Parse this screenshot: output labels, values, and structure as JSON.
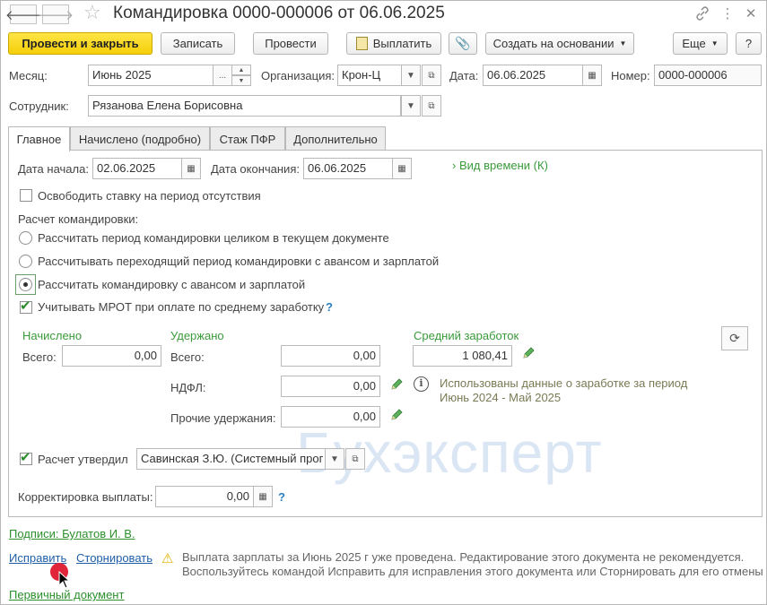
{
  "window": {
    "title": "Командировка 0000-000006 от 06.06.2025"
  },
  "toolbar": {
    "post_close": "Провести и закрыть",
    "save": "Записать",
    "post": "Провести",
    "pay": "Выплатить",
    "create_based": "Создать на основании",
    "more": "Еще",
    "help": "?"
  },
  "header": {
    "month_label": "Месяц:",
    "month_value": "Июнь 2025",
    "org_label": "Организация:",
    "org_value": "Крон-Ц",
    "date_label": "Дата:",
    "date_value": "06.06.2025",
    "number_label": "Номер:",
    "number_value": "0000-000006",
    "employee_label": "Сотрудник:",
    "employee_value": "Рязанова Елена Борисовна"
  },
  "tabs": [
    {
      "label": "Главное",
      "active": true
    },
    {
      "label": "Начислено (подробно)",
      "active": false
    },
    {
      "label": "Стаж ПФР",
      "active": false
    },
    {
      "label": "Дополнительно",
      "active": false
    }
  ],
  "main": {
    "start_label": "Дата начала:",
    "start_value": "02.06.2025",
    "end_label": "Дата окончания:",
    "end_value": "06.06.2025",
    "time_view": "Вид времени (К)",
    "free_rate": "Освободить ставку на период отсутствия",
    "calc_label": "Расчет командировки:",
    "options": [
      "Рассчитать период командировки целиком в текущем документе",
      "Рассчитывать переходящий период командировки с авансом и зарплатой",
      "Рассчитать командировку с авансом и зарплатой"
    ],
    "selected_option": 2,
    "mrot": "Учитывать МРОТ при оплате по среднему заработку",
    "mrot_checked": true,
    "help_mark": "?",
    "accrued_header": "Начислено",
    "withheld_header": "Удержано",
    "avg_header": "Средний заработок",
    "total_label": "Всего:",
    "accrued_total": "0,00",
    "withheld_total": "0,00",
    "ndfl_label": "НДФЛ:",
    "ndfl_value": "0,00",
    "other_label": "Прочие удержания:",
    "other_value": "0,00",
    "avg_value": "1 080,41",
    "info_text_1": "Использованы данные о заработке за период",
    "info_text_2": "Июнь 2024 - Май 2025",
    "approved_label": "Расчет утвердил",
    "approved_checked": true,
    "approved_value": "Савинская З.Ю. (Системный прог",
    "correction_label": "Корректировка выплаты:",
    "correction_value": "0,00"
  },
  "watermark": "Бухэксперт",
  "footer": {
    "signatures": "Подписи: Булатов И. В.",
    "fix": "Исправить",
    "reverse": "Сторнировать",
    "warning_1": "Выплата зарплаты за Июнь 2025 г уже проведена. Редактирование этого документа не рекомендуется.",
    "warning_2": "Воспользуйтесь командой Исправить для исправления этого документа или Сторнировать для его отмены",
    "primary_doc": "Первичный документ"
  },
  "colors": {
    "accent_yellow": "#f5cf0a",
    "green": "#3a9a3a",
    "link_blue": "#1f5fa8"
  }
}
